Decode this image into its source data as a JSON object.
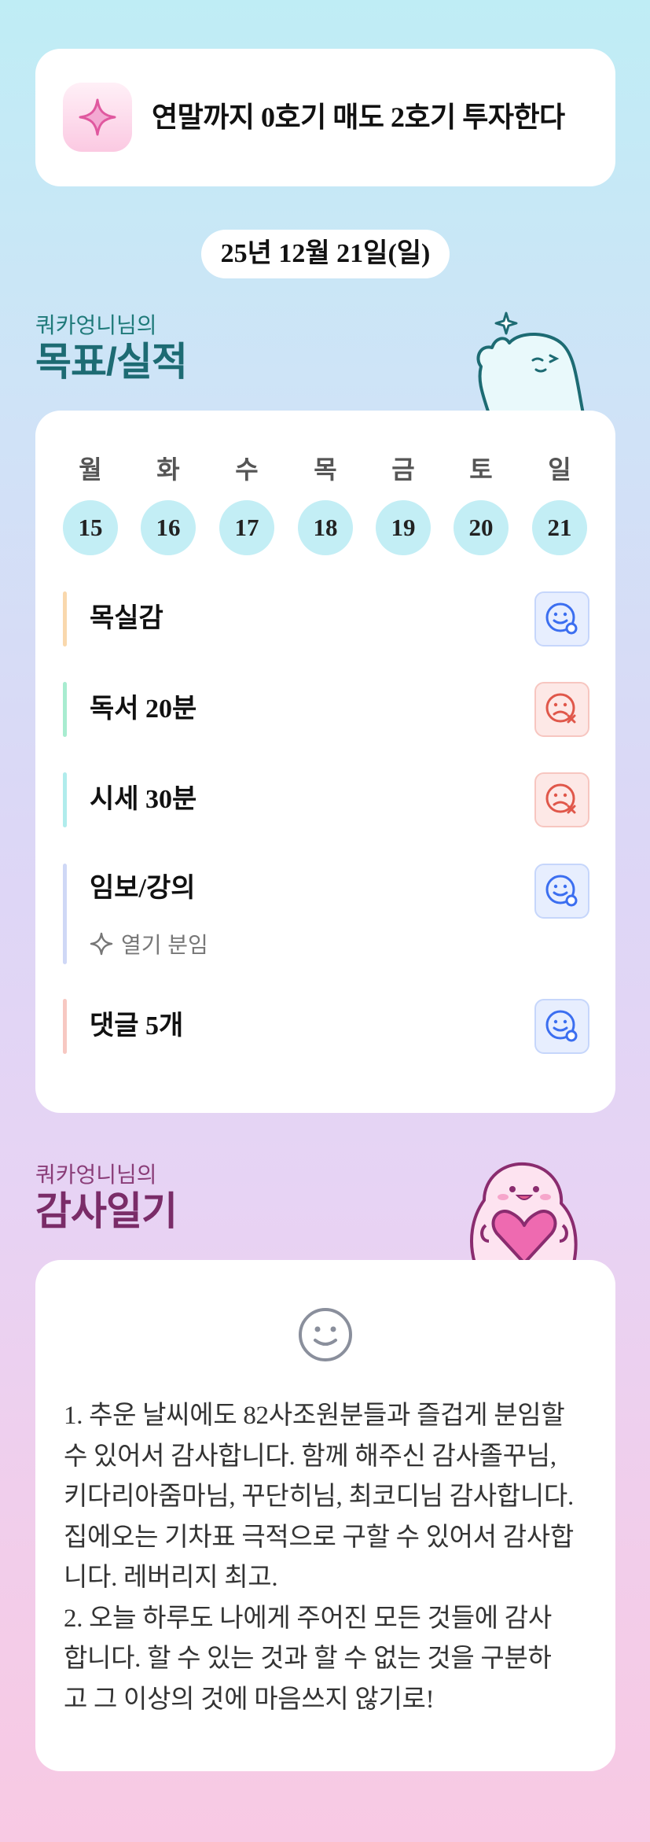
{
  "goal": {
    "text": "연말까지 0호기 매도 2호기 투자한다",
    "icon": "sparkle-icon"
  },
  "date": "25년 12월 21일(일)",
  "goals_section": {
    "subtitle": "쿼카엉니님의",
    "title": "목표/실적"
  },
  "week": {
    "days": [
      {
        "name": "월",
        "num": "15"
      },
      {
        "name": "화",
        "num": "16"
      },
      {
        "name": "수",
        "num": "17"
      },
      {
        "name": "목",
        "num": "18"
      },
      {
        "name": "금",
        "num": "19"
      },
      {
        "name": "토",
        "num": "20"
      },
      {
        "name": "일",
        "num": "21"
      }
    ]
  },
  "tasks": [
    {
      "label": "목실감",
      "status": "done",
      "bar_color": "#f9d8ad"
    },
    {
      "label": "독서 20분",
      "status": "failed",
      "bar_color": "#a8ecd0"
    },
    {
      "label": "시세 30분",
      "status": "failed",
      "bar_color": "#b0ecec"
    },
    {
      "label": "임보/강의",
      "status": "done",
      "bar_color": "#cfd8f6",
      "note": "열기 분임",
      "note_icon": "sparkle-outline-icon"
    },
    {
      "label": "댓글 5개",
      "status": "done",
      "bar_color": "#f7c8c2"
    }
  ],
  "thanks_section": {
    "subtitle": "쿼카엉니님의",
    "title": "감사일기"
  },
  "diary": {
    "icon": "smiley-icon",
    "lines": [
      "1. 추운 날씨에도 82사조원분들과 즐겁게 분임할",
      "수 있어서 감사합니다. 함께 해주신 감사졸꾸님,",
      "키다리아줌마님, 꾸단히님, 최코디님 감사합니다.",
      "집에오는 기차표 극적으로 구할 수 있어서 감사합",
      "니다. 레버리지 최고.",
      "2. 오늘 하루도 나에게 주어진 모든 것들에 감사",
      "합니다. 할 수 있는 것과 할 수 없는 것을 구분하",
      "고 그 이상의 것에 마음쓰지 않기로!"
    ]
  },
  "colors": {
    "accent_teal": "#1d6b73",
    "accent_plum": "#7a2c68",
    "ok_blue": "#3b6ef0",
    "fail_red": "#e0574a"
  }
}
